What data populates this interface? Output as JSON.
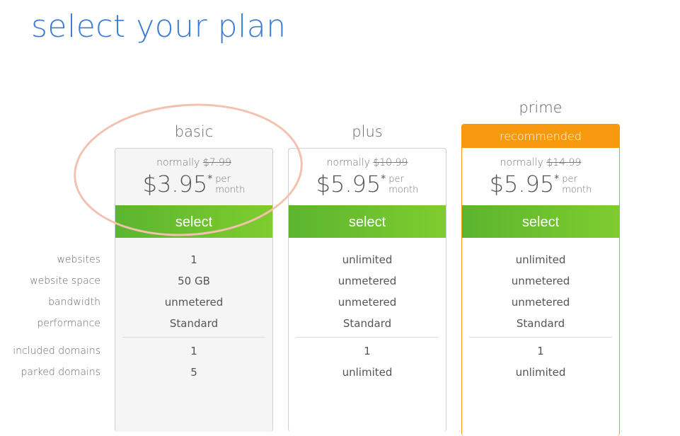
{
  "header": {
    "title": "select your plan"
  },
  "row_labels": [
    "websites",
    "website space",
    "bandwidth",
    "performance",
    "included domains",
    "parked domains"
  ],
  "plans": [
    {
      "name": "basic",
      "badge": null,
      "normally_label": "normally",
      "old_price": "$7.99",
      "price": "$3.95",
      "asterisk": "*",
      "per_line1": "per",
      "per_line2": "month",
      "select_label": "select",
      "features": [
        "1",
        "50 GB",
        "unmetered",
        "Standard",
        "1",
        "5"
      ]
    },
    {
      "name": "plus",
      "badge": null,
      "normally_label": "normally",
      "old_price": "$10.99",
      "price": "$5.95",
      "asterisk": "*",
      "per_line1": "per",
      "per_line2": "month",
      "select_label": "select",
      "features": [
        "unlimited",
        "unmetered",
        "unmetered",
        "Standard",
        "1",
        "unlimited"
      ]
    },
    {
      "name": "prime",
      "badge": "recommended",
      "normally_label": "normally",
      "old_price": "$14.99",
      "price": "$5.95",
      "asterisk": "*",
      "per_line1": "per",
      "per_line2": "month",
      "select_label": "select",
      "features": [
        "unlimited",
        "unmetered",
        "unmetered",
        "Standard",
        "1",
        "unlimited"
      ]
    }
  ],
  "colors": {
    "title": "#3a7bd5",
    "select_green_start": "#5bb52f",
    "select_green_end": "#7fcc2f",
    "recommended_orange": "#f7990c",
    "annotation_circle": "#f5c0ae"
  }
}
